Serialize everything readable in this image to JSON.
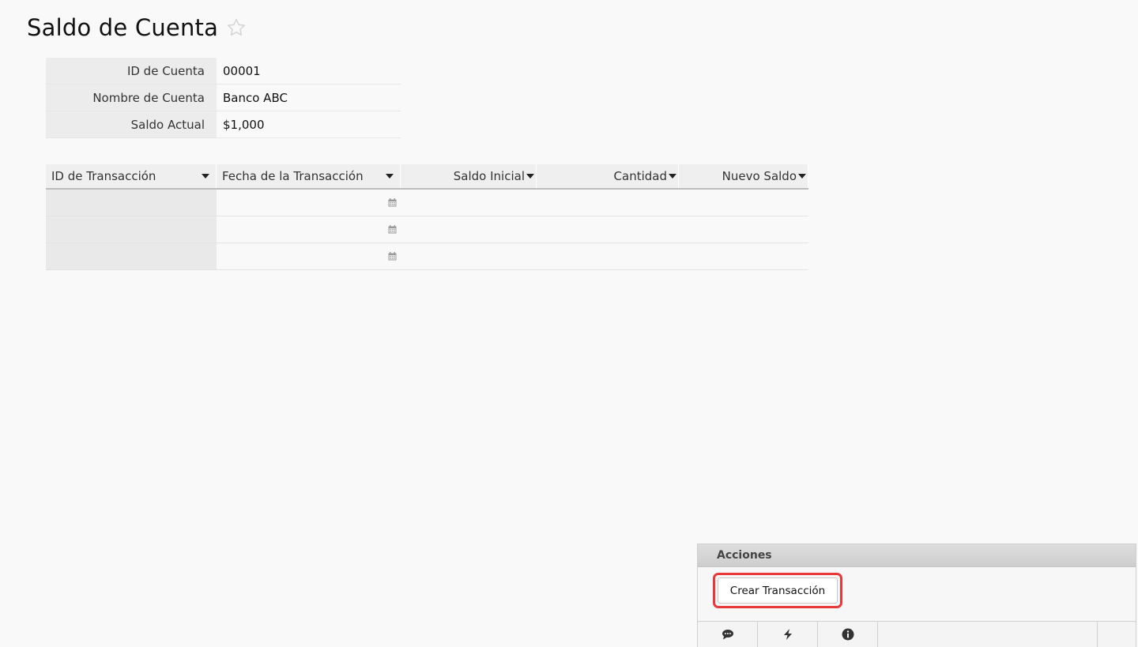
{
  "page": {
    "title": "Saldo de Cuenta"
  },
  "account": {
    "rows": [
      {
        "label": "ID de Cuenta",
        "value": "00001"
      },
      {
        "label": "Nombre de Cuenta",
        "value": "Banco ABC"
      },
      {
        "label": "Saldo Actual",
        "value": "$1,000"
      }
    ]
  },
  "transactions": {
    "columns": [
      "ID de Transacción",
      "Fecha de la Transacción",
      "Saldo Inicial",
      "Cantidad",
      "Nuevo Saldo"
    ],
    "row_count": 3
  },
  "actions": {
    "header": "Acciones",
    "create_label": "Crear Transacción"
  },
  "icons": {
    "star": "star-outline-icon",
    "caret": "caret-down-icon",
    "calendar": "calendar-icon",
    "comment": "comment-icon",
    "bolt": "bolt-icon",
    "info": "info-circle-icon"
  },
  "colors": {
    "highlight": "#e8383a"
  }
}
